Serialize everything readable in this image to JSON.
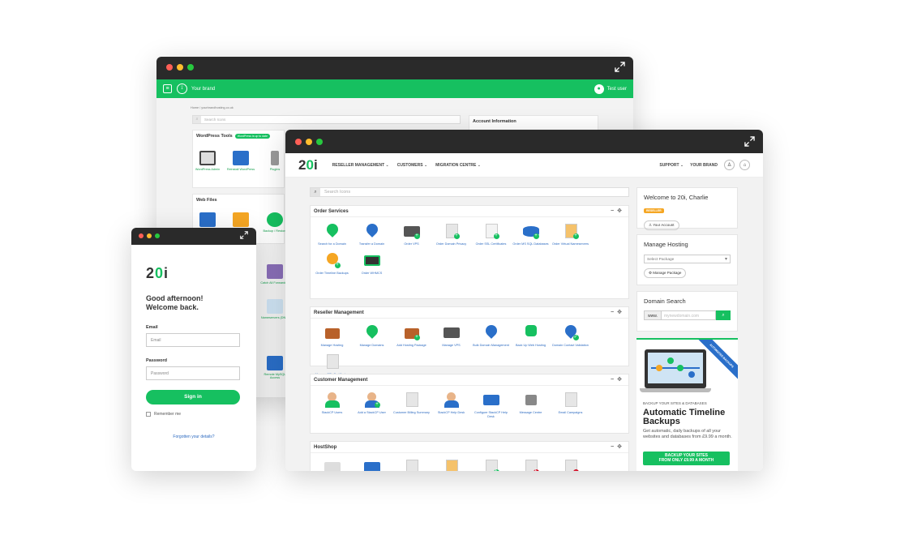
{
  "back": {
    "brand": "Your brand",
    "user": "Test user",
    "breadcrumb": "Home / yourbrandhosting.co.uk",
    "search_placeholder": "Search Icons",
    "account_title": "Account Information",
    "wp_title": "WordPress Tools",
    "wp_badge": "WordPress is up to date",
    "wp_icons": [
      "WordPress Admin",
      "Reinstall WordPress",
      "Plugins"
    ],
    "web_files_title": "Web Files",
    "web_icons": [
      "",
      "",
      "Backup / Restore"
    ],
    "side_icons": [
      "Catch All Forwarders",
      "Nameservers (DNS)",
      "Remote MySQL Access"
    ]
  },
  "login": {
    "greeting1": "Good afternoon!",
    "greeting2": "Welcome back.",
    "email_label": "Email",
    "email_placeholder": "Email",
    "password_label": "Password",
    "password_placeholder": "Password",
    "signin": "Sign in",
    "remember": "Remember me",
    "forgot": "Forgotten your details?"
  },
  "front": {
    "menu": [
      "RESELLER MANAGEMENT ⌄",
      "CUSTOMERS ⌄",
      "MIGRATION CENTRE ⌄"
    ],
    "support": "SUPPORT ⌄",
    "your_brand": "YOUR BRAND",
    "search_placeholder": "Search Icons",
    "sections": [
      {
        "title": "Order Services",
        "icons": [
          "Search for a Domain",
          "Transfer a Domain",
          "Order VPS",
          "Order Domain Privacy",
          "Order SSL Certificates",
          "Order MS SQL Databases",
          "Order Virtual Nameservers",
          "Order Timeline Backups",
          "Order WHMCS"
        ]
      },
      {
        "title": "Reseller Management",
        "icons": [
          "Manage Hosting",
          "Manage Domains",
          "Add Hosting Package",
          "Manage VPS",
          "Bulk Domain Management",
          "Back Up Web Hosting",
          "Domain Contact Validation",
          "Manage SSL Certificates"
        ]
      },
      {
        "title": "Customer Management",
        "icons": [
          "StackCP Users",
          "Add a StackCP User",
          "Customer Billing Summary",
          "StackCP Help Desk",
          "Configure StackCP Help Desk",
          "Message Centre",
          "Email Campaigns"
        ]
      },
      {
        "title": "HostShop",
        "icons": [
          "",
          "",
          "",
          "",
          "",
          "",
          "",
          ""
        ]
      }
    ],
    "welcome": "Welcome to 20i, Charlie",
    "reseller_badge": "RESELLER",
    "your_account": "Your Account",
    "manage_hosting": "Manage Hosting",
    "select_package": "Select Package",
    "manage_package": "Manage Package",
    "domain_search": "Domain Search",
    "domain_prefix": "www.",
    "domain_placeholder": "mynewdomain.com",
    "promo_ribbon": "AUTOMATED BACKUPS",
    "promo_kicker": "BACKUP YOUR SITES & DATABASES",
    "promo_title": "Automatic Timeline Backups",
    "promo_text": "Get automatic, daily backups of all your websites and databases from £9.99 a month.",
    "promo_btn1": "BACKUP YOUR SITES",
    "promo_btn2": "FROM ONLY £9.99 A MONTH"
  }
}
